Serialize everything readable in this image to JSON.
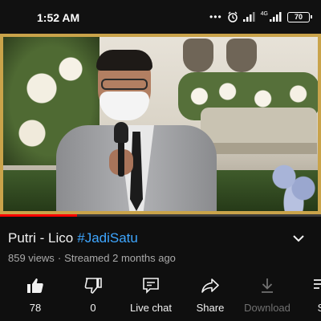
{
  "status_bar": {
    "time": "1:52 AM",
    "dots": "•••",
    "network": "4G",
    "battery": "70"
  },
  "video": {
    "progress_percent": 24
  },
  "title": {
    "text": "Putri - Lico",
    "hashtag": "#JadiSatu"
  },
  "meta": {
    "views": "859 views",
    "separator": "·",
    "streamed": "Streamed 2 months ago"
  },
  "actions": [
    {
      "icon": "thumbs-up-icon",
      "label": "78"
    },
    {
      "icon": "thumbs-down-icon",
      "label": "0"
    },
    {
      "icon": "live-chat-icon",
      "label": "Live chat"
    },
    {
      "icon": "share-icon",
      "label": "Share"
    },
    {
      "icon": "download-icon",
      "label": "Download"
    },
    {
      "icon": "save-icon",
      "label": "S"
    }
  ],
  "colors": {
    "hashtag": "#3ea6ff",
    "progress": "#ff0000",
    "frame_border": "#c9a34a"
  }
}
